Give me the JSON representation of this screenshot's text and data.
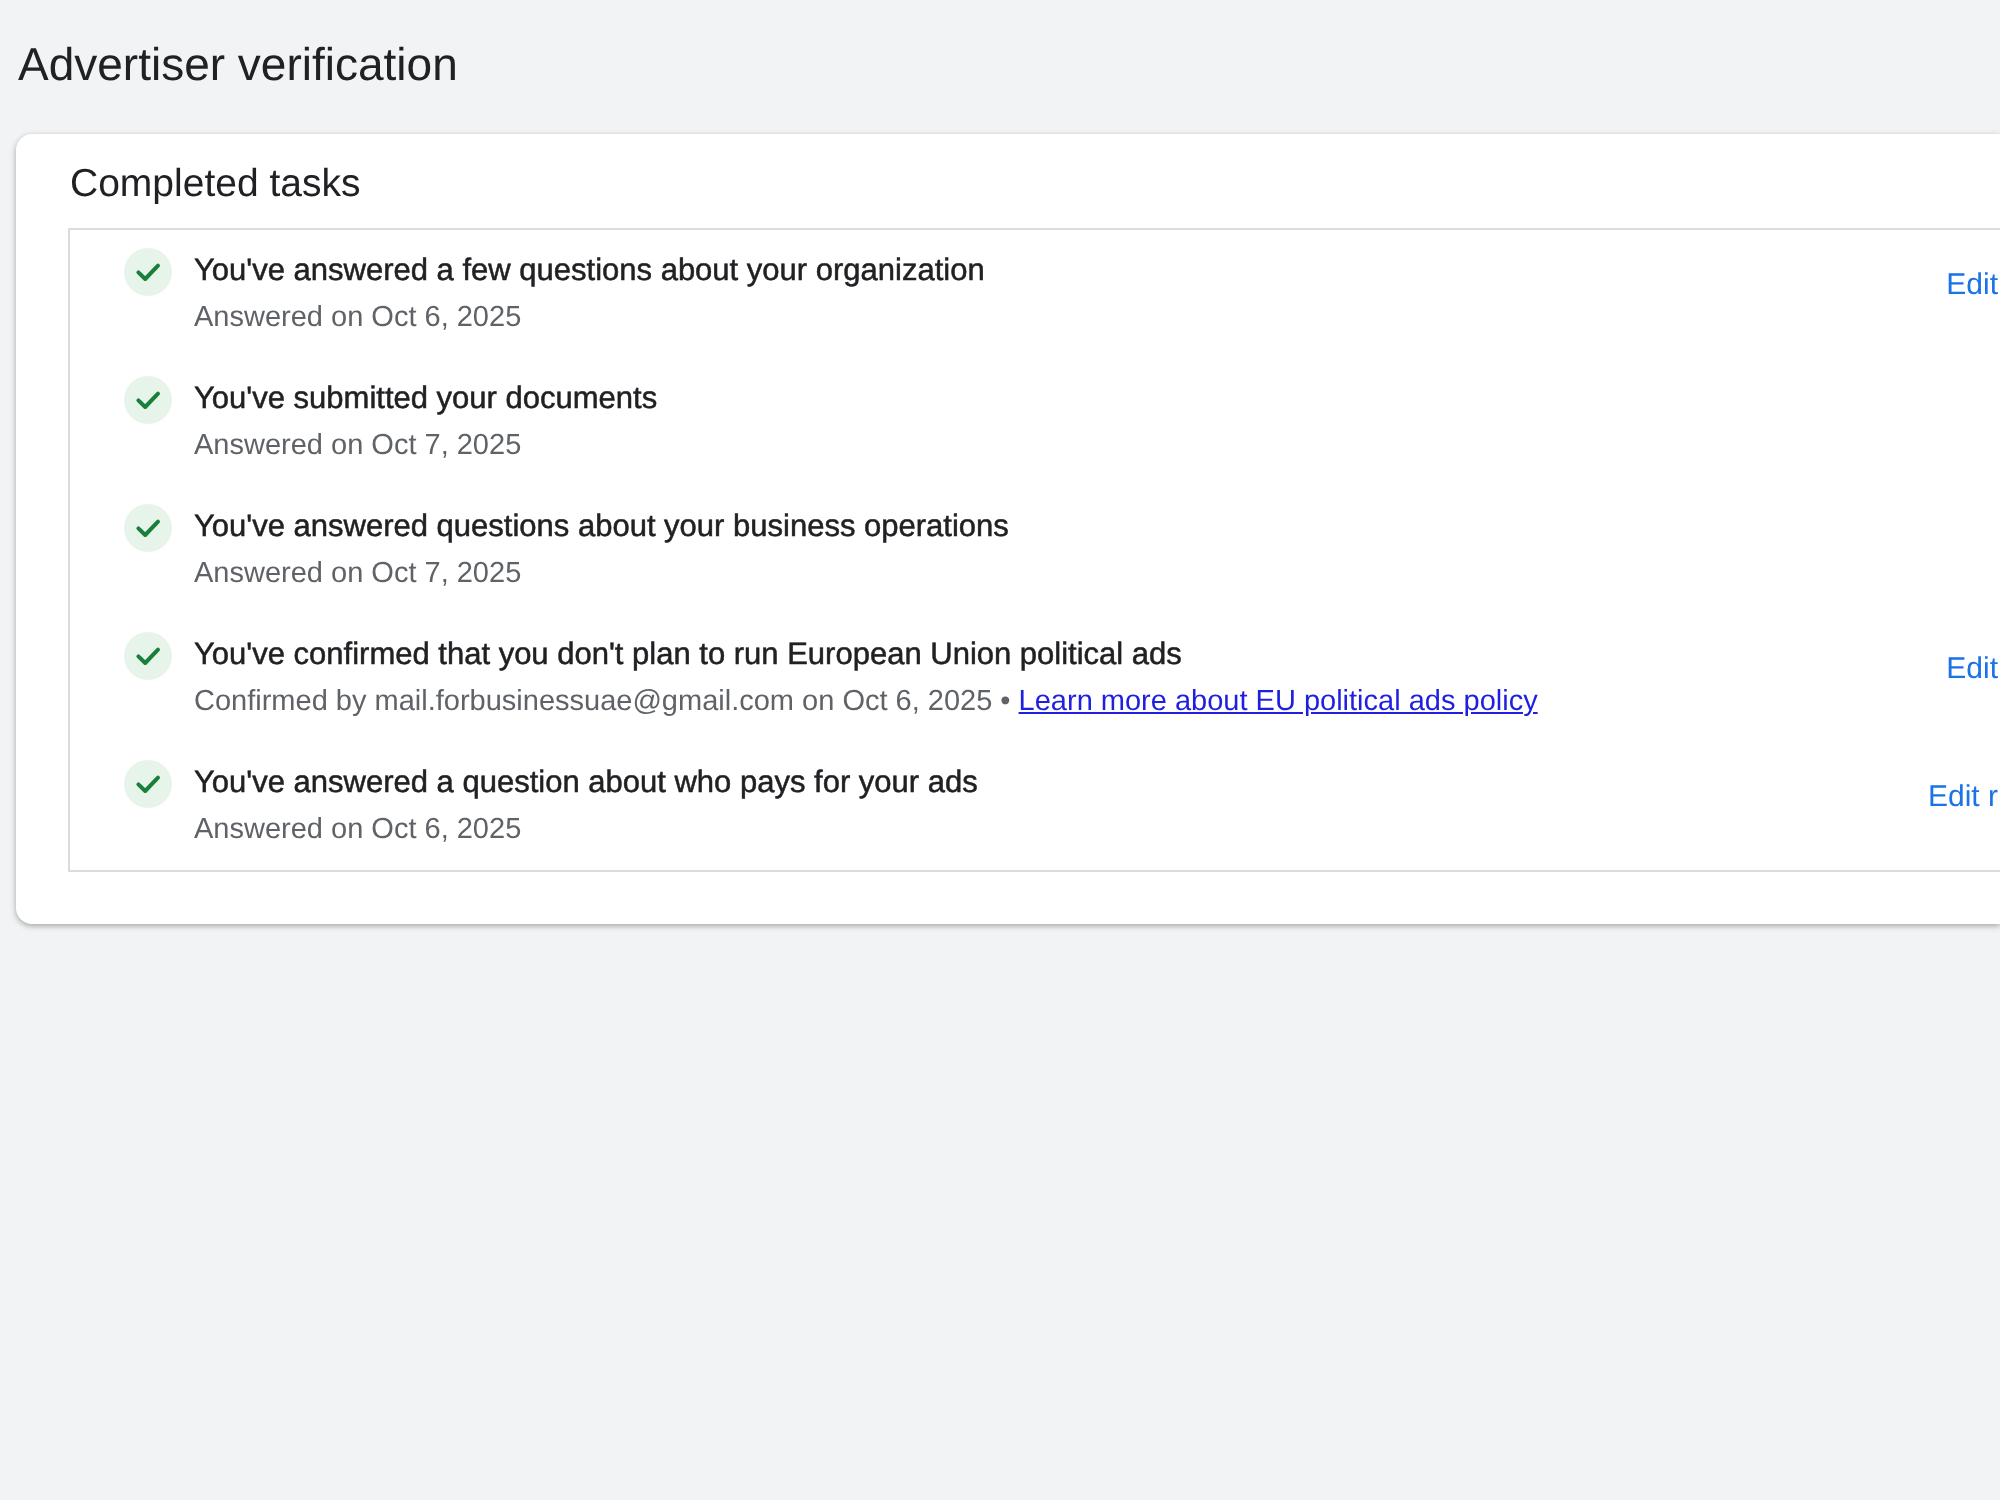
{
  "page": {
    "title": "Advertiser verification"
  },
  "completed_tasks": {
    "heading": "Completed tasks",
    "tasks": [
      {
        "title": "You've answered a few questions about your organization",
        "detail": "Answered on Oct 6, 2025",
        "done": true,
        "action": "Edit"
      },
      {
        "title": "You've submitted your documents",
        "detail": "Answered on Oct 7, 2025",
        "done": true
      },
      {
        "title": "You've answered questions about your business operations",
        "detail": "Answered on Oct 7, 2025",
        "done": true
      },
      {
        "title": "You've confirmed that you don't plan to run European Union political ads",
        "detail": "Confirmed by mail.forbusinessuae@gmail.com on Oct 6, 2025",
        "separator": "•",
        "link": "Learn more about EU political ads policy",
        "done": true,
        "action": "Edit"
      },
      {
        "title": "You've answered a question about who pays for your ads",
        "detail": "Answered on Oct 6, 2025",
        "done": true,
        "action": "Edit r"
      }
    ]
  }
}
